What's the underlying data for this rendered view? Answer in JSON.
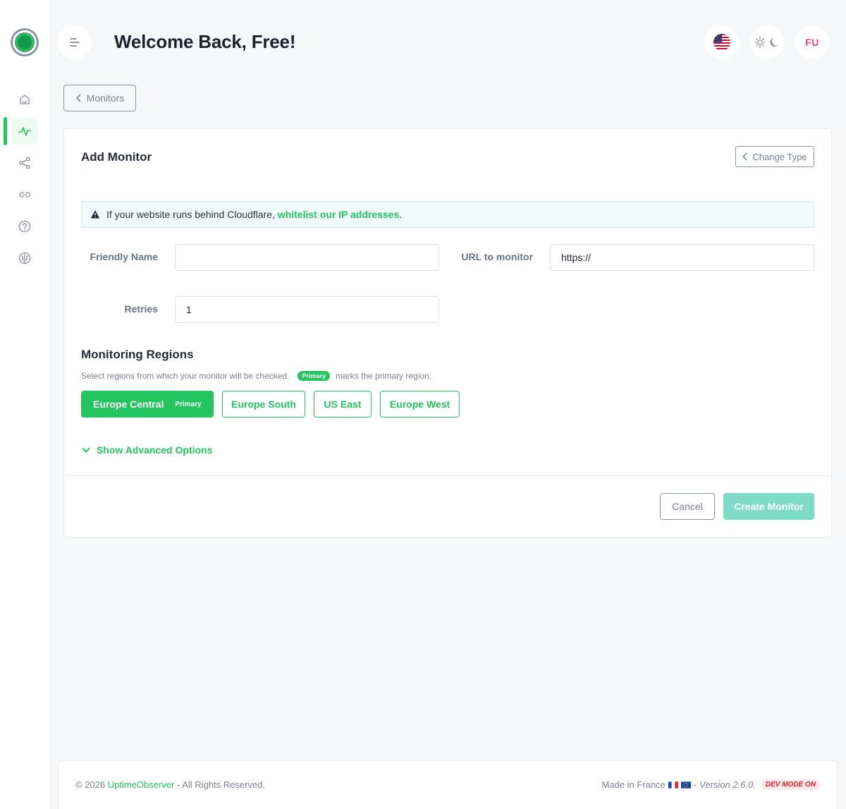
{
  "header": {
    "welcome": "Welcome Back, Free!",
    "avatar_initials": "FU"
  },
  "sidebar": {
    "items": [
      {
        "icon": "home-icon"
      },
      {
        "icon": "activity-icon",
        "active": true
      },
      {
        "icon": "share-icon"
      },
      {
        "icon": "link-icon"
      },
      {
        "icon": "help-icon"
      },
      {
        "icon": "brain-icon"
      }
    ]
  },
  "breadcrumb": {
    "back_label": "Monitors"
  },
  "card": {
    "title": "Add Monitor",
    "change_type_label": "Change Type",
    "alert": {
      "text_before": "If your website runs behind Cloudflare,",
      "link_text": "whitelist our IP addresses",
      "text_after": "."
    },
    "fields": {
      "friendly_name_label": "Friendly Name",
      "friendly_name_value": "",
      "url_label": "URL to monitor",
      "url_value": "https://",
      "retries_label": "Retries",
      "retries_value": "1"
    },
    "regions": {
      "title": "Monitoring Regions",
      "help_before": "Select regions from which your monitor will be checked.",
      "help_pill": "Primary",
      "help_after": "marks the primary region.",
      "items": [
        {
          "label": "Europe Central",
          "tag": "Primary",
          "selected": true
        },
        {
          "label": "Europe South",
          "selected": false
        },
        {
          "label": "US East",
          "selected": false
        },
        {
          "label": "Europe West",
          "selected": false
        }
      ]
    },
    "advanced_label": "Show Advanced Options",
    "cancel_label": "Cancel",
    "create_label": "Create Monitor"
  },
  "footer": {
    "copyright": "© 2026",
    "brand": "UptimeObserver",
    "rights": "- All Rights Reserved.",
    "made_in": "Made in France",
    "dash": "-",
    "version": "Version 2.6.0.",
    "dev_mode": "DEV MODE ON"
  },
  "colors": {
    "accent": "#22c55e",
    "create_disabled": "#7ddcc8",
    "avatar_text": "#e8467c",
    "dev_badge": "#e02424"
  }
}
